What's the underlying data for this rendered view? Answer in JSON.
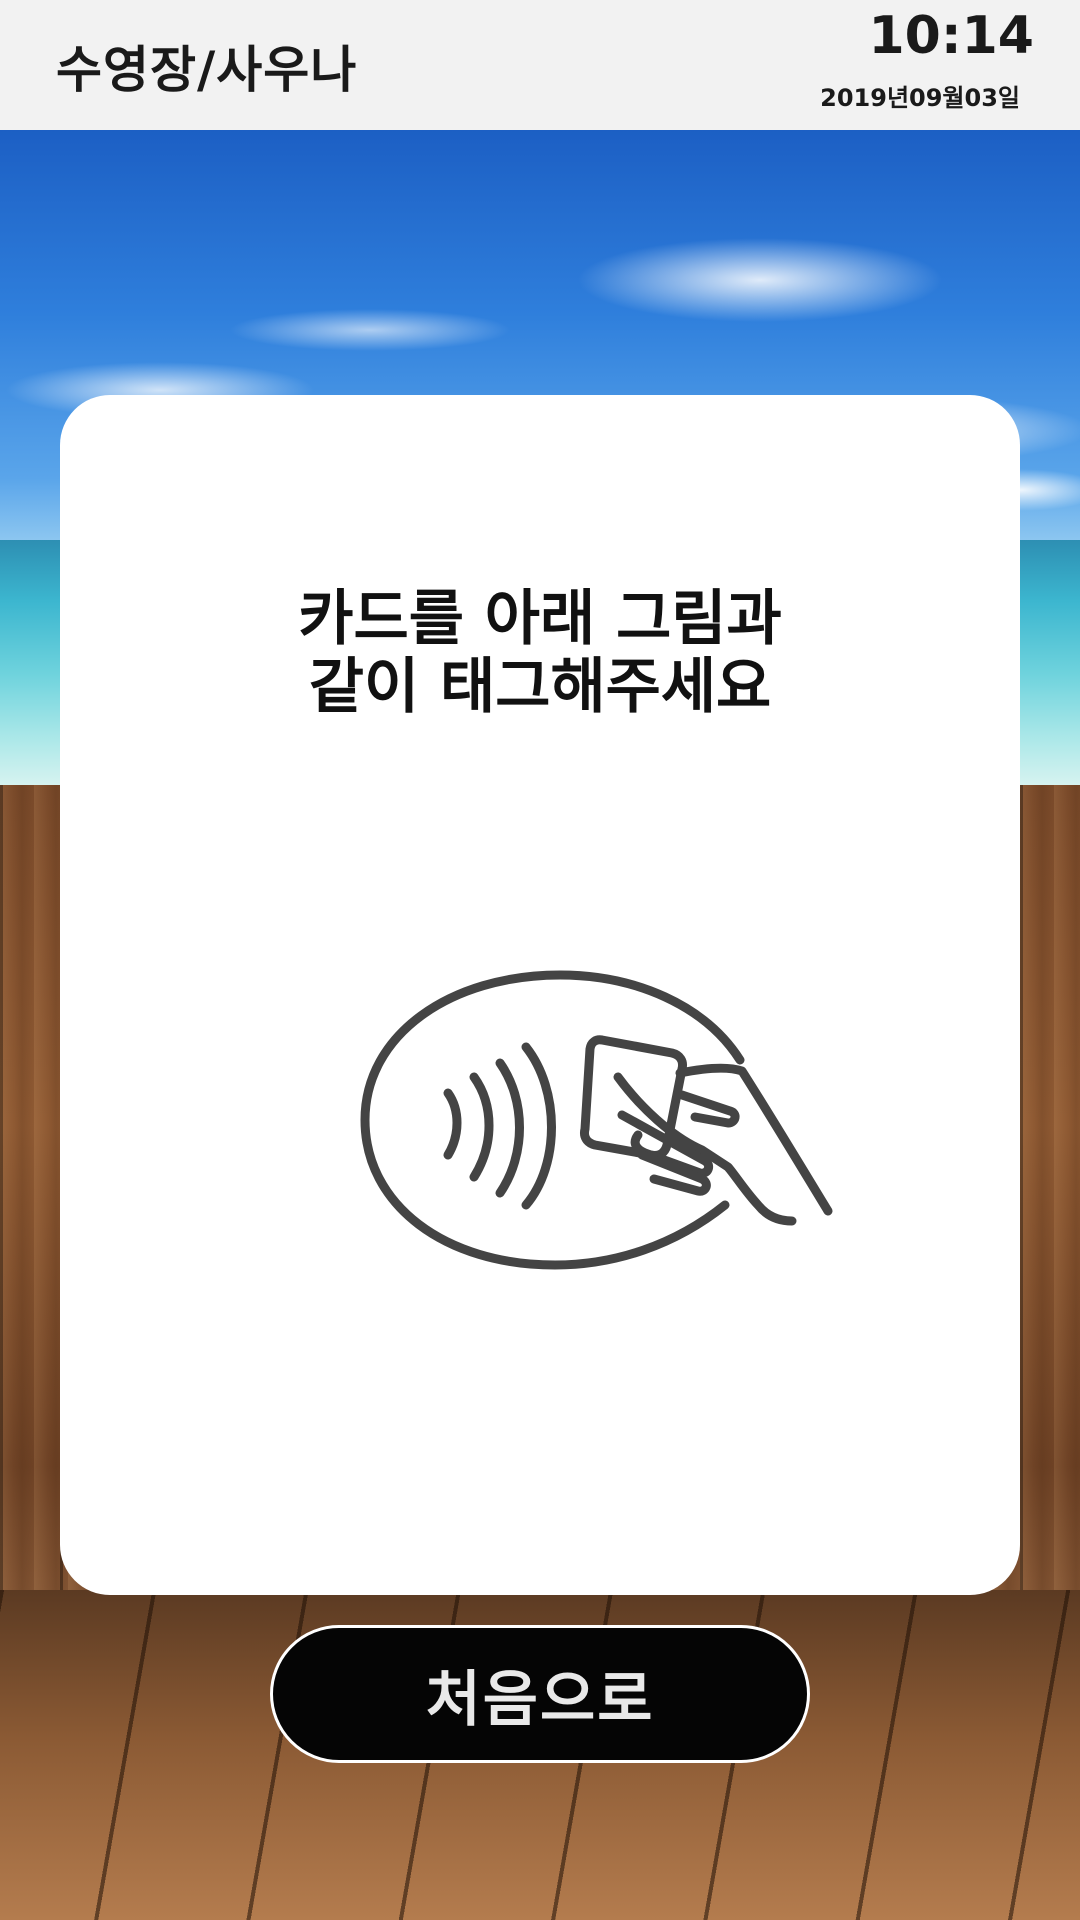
{
  "header": {
    "title": "수영장/사우나",
    "time": "10:14",
    "date": "2019년09월03일"
  },
  "panel": {
    "instruction_line1": "카드를 아래 그림과",
    "instruction_line2": "같이 태그해주세요",
    "illustration_icon": "contactless-card-tap-icon"
  },
  "buttons": {
    "home_label": "처음으로"
  },
  "colors": {
    "header_bg": "#f2f2f2",
    "panel_bg": "#ffffff",
    "icon_stroke": "#444444",
    "button_bg": "#050505",
    "button_text": "#e9e9e9"
  }
}
